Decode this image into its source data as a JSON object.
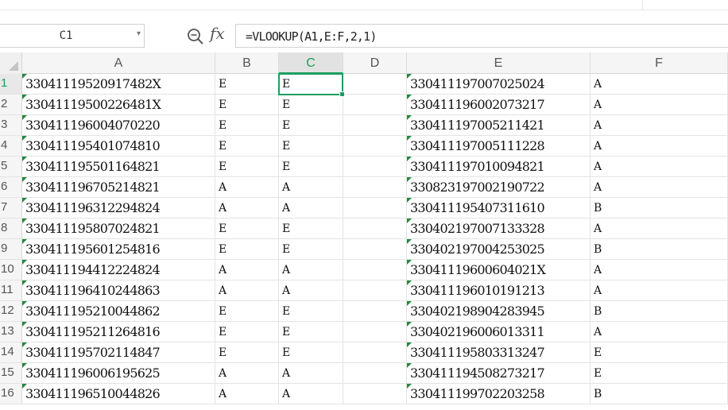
{
  "name_box": {
    "value": "C1"
  },
  "formula_bar": {
    "formula": "=VLOOKUP(A1,E:F,2,1)",
    "fx_label": "fx",
    "zoom_icon": "zoom-search-icon"
  },
  "columns": [
    "A",
    "B",
    "C",
    "D",
    "E",
    "F"
  ],
  "active_column": "C",
  "active_cell": "C1",
  "rows": [
    {
      "row": "1",
      "A": "33041119520917482X",
      "B": "E",
      "C": "E",
      "D": "",
      "E": "330411197007025024",
      "F": "A"
    },
    {
      "row": "2",
      "A": "33041119500226481X",
      "B": "E",
      "C": "E",
      "D": "",
      "E": "330411196002073217",
      "F": "A"
    },
    {
      "row": "3",
      "A": "330411196004070220",
      "B": "E",
      "C": "E",
      "D": "",
      "E": "330411197005211421",
      "F": "A"
    },
    {
      "row": "4",
      "A": "330411195401074810",
      "B": "E",
      "C": "E",
      "D": "",
      "E": "330411197005111228",
      "F": "A"
    },
    {
      "row": "5",
      "A": "330411195501164821",
      "B": "E",
      "C": "E",
      "D": "",
      "E": "330411197010094821",
      "F": "A"
    },
    {
      "row": "6",
      "A": "330411196705214821",
      "B": "A",
      "C": "A",
      "D": "",
      "E": "330823197002190722",
      "F": "A"
    },
    {
      "row": "7",
      "A": "330411196312294824",
      "B": "A",
      "C": "A",
      "D": "",
      "E": "330411195407311610",
      "F": "B"
    },
    {
      "row": "8",
      "A": "330411195807024821",
      "B": "E",
      "C": "E",
      "D": "",
      "E": "330402197007133328",
      "F": "A"
    },
    {
      "row": "9",
      "A": "330411195601254816",
      "B": "E",
      "C": "E",
      "D": "",
      "E": "330402197004253025",
      "F": "B"
    },
    {
      "row": "10",
      "A": "330411194412224824",
      "B": "A",
      "C": "A",
      "D": "",
      "E": "33041119600604021X",
      "F": "A"
    },
    {
      "row": "11",
      "A": "330411196410244863",
      "B": "A",
      "C": "A",
      "D": "",
      "E": "330411196010191213",
      "F": "A"
    },
    {
      "row": "12",
      "A": "330411195210044862",
      "B": "E",
      "C": "E",
      "D": "",
      "E": "330402198904283945",
      "F": "B"
    },
    {
      "row": "13",
      "A": "330411195211264816",
      "B": "E",
      "C": "E",
      "D": "",
      "E": "330402196006013311",
      "F": "A"
    },
    {
      "row": "14",
      "A": "330411195702114847",
      "B": "E",
      "C": "E",
      "D": "",
      "E": "330411195803313247",
      "F": "E"
    },
    {
      "row": "15",
      "A": "330411196006195625",
      "B": "A",
      "C": "A",
      "D": "",
      "E": "330411194508273217",
      "F": "E"
    },
    {
      "row": "16",
      "A": "330411196510044826",
      "B": "A",
      "C": "A",
      "D": "",
      "E": "330411199702203258",
      "F": "B"
    }
  ],
  "colors": {
    "accent": "#1f9d60",
    "text_marker": "#1f8a3a"
  }
}
